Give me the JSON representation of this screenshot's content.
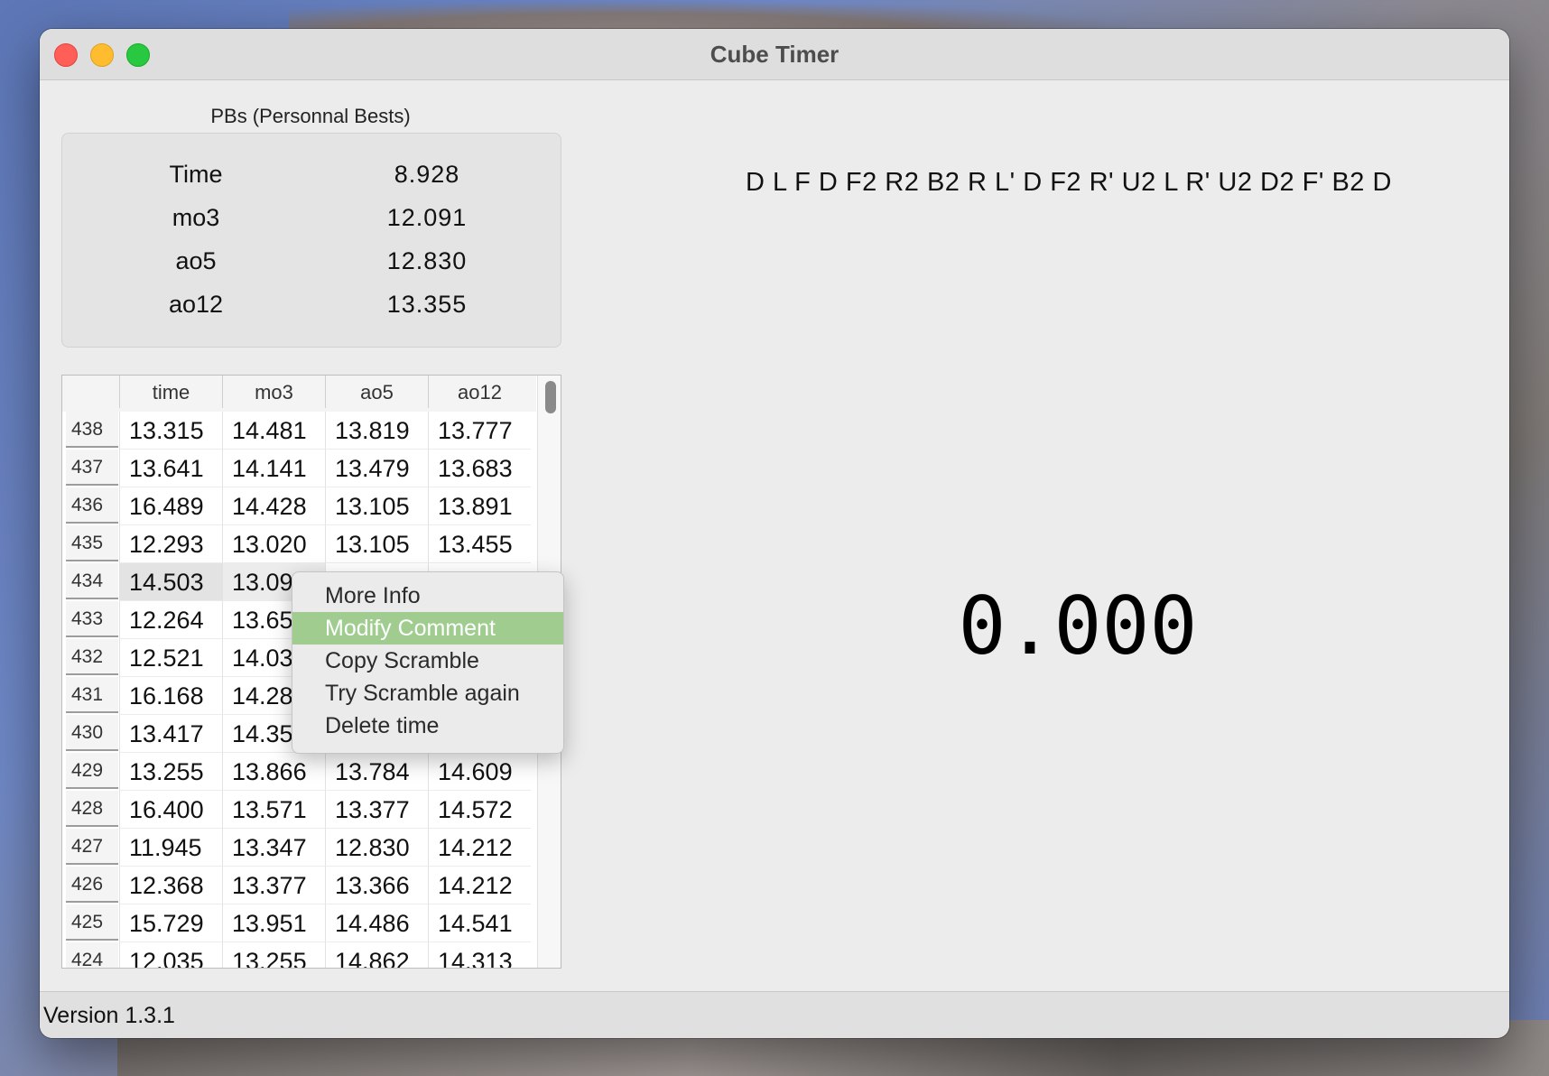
{
  "window": {
    "title": "Cube Timer"
  },
  "pbs": {
    "title": "PBs (Personnal Bests)",
    "rows": [
      {
        "label": "Time",
        "value": "8.928"
      },
      {
        "label": "mo3",
        "value": "12.091"
      },
      {
        "label": "ao5",
        "value": "12.830"
      },
      {
        "label": "ao12",
        "value": "13.355"
      }
    ]
  },
  "table": {
    "columns": [
      "time",
      "mo3",
      "ao5",
      "ao12"
    ],
    "rows": [
      {
        "n": "438",
        "cells": [
          "13.315",
          "14.481",
          "13.819",
          "13.777"
        ]
      },
      {
        "n": "437",
        "cells": [
          "13.641",
          "14.141",
          "13.479",
          "13.683"
        ]
      },
      {
        "n": "436",
        "cells": [
          "16.489",
          "14.428",
          "13.105",
          "13.891"
        ]
      },
      {
        "n": "435",
        "cells": [
          "12.293",
          "13.020",
          "13.105",
          "13.455"
        ]
      },
      {
        "n": "434",
        "cells": [
          "14.503",
          "13.09",
          "",
          ""
        ]
      },
      {
        "n": "433",
        "cells": [
          "12.264",
          "13.65",
          "",
          ""
        ]
      },
      {
        "n": "432",
        "cells": [
          "12.521",
          "14.03",
          "",
          ""
        ]
      },
      {
        "n": "431",
        "cells": [
          "16.168",
          "14.28",
          "",
          ""
        ]
      },
      {
        "n": "430",
        "cells": [
          "13.417",
          "14.35",
          "",
          ""
        ]
      },
      {
        "n": "429",
        "cells": [
          "13.255",
          "13.866",
          "13.784",
          "14.609"
        ]
      },
      {
        "n": "428",
        "cells": [
          "16.400",
          "13.571",
          "13.377",
          "14.572"
        ]
      },
      {
        "n": "427",
        "cells": [
          "11.945",
          "13.347",
          "12.830",
          "14.212"
        ]
      },
      {
        "n": "426",
        "cells": [
          "12.368",
          "13.377",
          "13.366",
          "14.212"
        ]
      },
      {
        "n": "425",
        "cells": [
          "15.729",
          "13.951",
          "14.486",
          "14.541"
        ]
      },
      {
        "n": "424",
        "cells": [
          "12.035",
          "13.255",
          "14.862",
          "14.313"
        ]
      }
    ],
    "selected_row": "434"
  },
  "context_menu": {
    "items": [
      "More Info",
      "Modify Comment",
      "Copy Scramble",
      "Try Scramble again",
      "Delete time"
    ],
    "active": "Modify Comment",
    "active_color": "#a0cd8f"
  },
  "scramble": "D L F D F2 R2 B2 R L' D F2 R' U2 L R' U2 D2 F' B2 D",
  "timer": "0.000",
  "status": {
    "version": "Version 1.3.1"
  }
}
